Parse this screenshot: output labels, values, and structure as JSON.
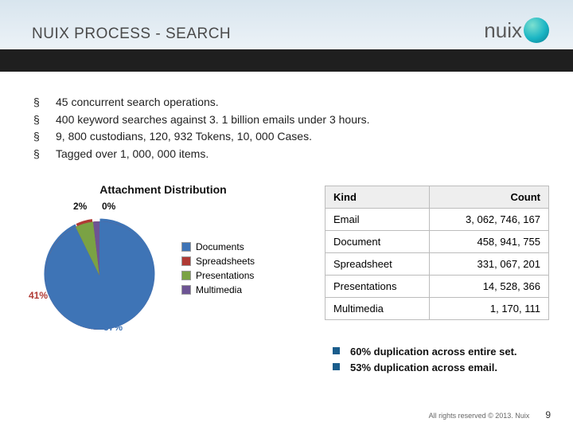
{
  "header": {
    "title": "NUIX PROCESS - SEARCH",
    "logo_text": "nuix"
  },
  "bullets": [
    "45 concurrent search operations.",
    "400 keyword searches against 3. 1 billion emails under 3 hours.",
    "9, 800 custodians, 120, 932 Tokens, 10, 000 Cases.",
    "Tagged over 1, 000, 000 items."
  ],
  "chart": {
    "title": "Attachment Distribution",
    "legend": [
      {
        "label": "Documents",
        "color": "#3e74b6"
      },
      {
        "label": "Spreadsheets",
        "color": "#b03a34"
      },
      {
        "label": "Presentations",
        "color": "#7aa244"
      },
      {
        "label": "Multimedia",
        "color": "#6d5494"
      }
    ],
    "labels": {
      "p2": "2%",
      "p0": "0%",
      "p41": "41%",
      "p57": "57%"
    }
  },
  "chart_data": {
    "type": "pie",
    "title": "Attachment Distribution",
    "categories": [
      "Documents",
      "Spreadsheets",
      "Presentations",
      "Multimedia"
    ],
    "values": [
      57,
      41,
      2,
      0
    ],
    "colors": [
      "#3e74b6",
      "#b03a34",
      "#7aa244",
      "#6d5494"
    ]
  },
  "table": {
    "headers": {
      "kind": "Kind",
      "count": "Count"
    },
    "rows": [
      {
        "kind": "Email",
        "count": "3, 062, 746, 167"
      },
      {
        "kind": "Document",
        "count": "458, 941, 755"
      },
      {
        "kind": "Spreadsheet",
        "count": "331, 067, 201"
      },
      {
        "kind": "Presentations",
        "count": "14, 528, 366"
      },
      {
        "kind": "Multimedia",
        "count": "1, 170, 111"
      }
    ]
  },
  "notes": [
    "60% duplication across entire set.",
    "53% duplication across email."
  ],
  "footer": {
    "copyright": "All rights reserved © 2013. Nuix",
    "page": "9"
  }
}
